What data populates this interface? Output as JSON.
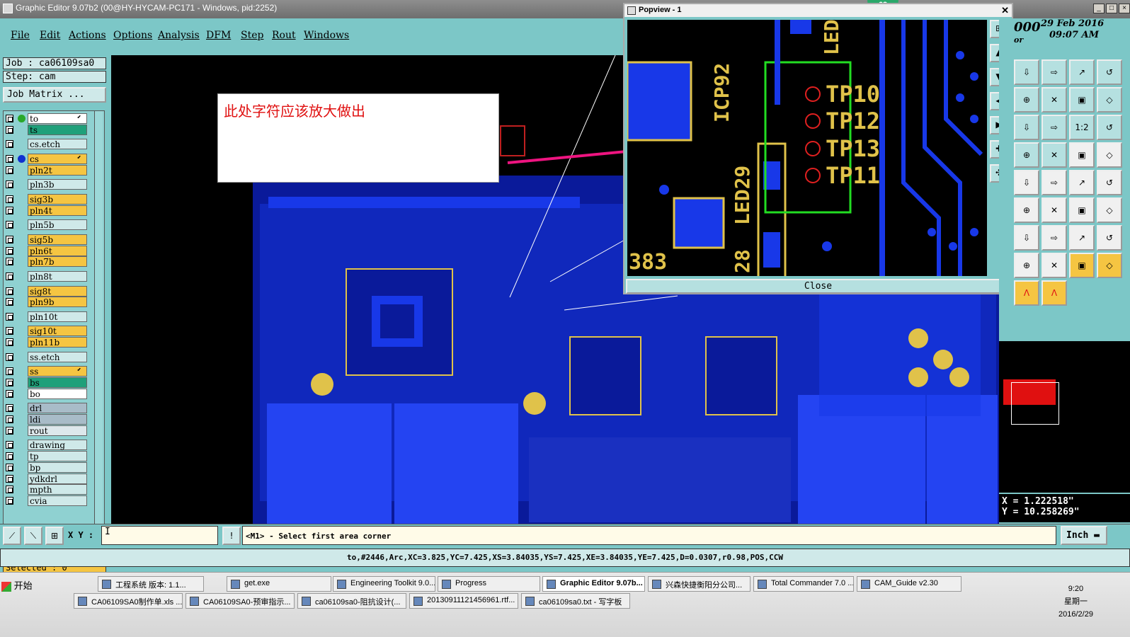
{
  "window": {
    "title": "Graphic Editor 9.07b2 (00@HY-HYCAM-PC171 - Windows, pid:2252)"
  },
  "menu": [
    "File",
    "Edit",
    "Actions",
    "Options",
    "Analysis",
    "DFM",
    "Step",
    "Rout",
    "Windows"
  ],
  "job": {
    "job_label": "Job : ca06109sa0",
    "step_label": "Step: cam",
    "matrix_button": "Job Matrix ..."
  },
  "layers": [
    {
      "name": "to",
      "color": "#ffffff",
      "dot": "#2aa82a",
      "arrow": true
    },
    {
      "name": "ts",
      "color": "#1fa07a"
    },
    {
      "name": "cs.etch",
      "color": "#cfe9e9"
    },
    {
      "name": "cs",
      "color": "#f5c542",
      "dot": "#1030d0",
      "arrow": true
    },
    {
      "name": "pln2t",
      "color": "#f5c542"
    },
    {
      "name": "pln3b",
      "color": "#cfe9e9"
    },
    {
      "name": "sig3b",
      "color": "#f5c542"
    },
    {
      "name": "pln4t",
      "color": "#f5c542"
    },
    {
      "name": "pln5b",
      "color": "#cfe9e9"
    },
    {
      "name": "sig5b",
      "color": "#f5c542"
    },
    {
      "name": "pln6t",
      "color": "#f5c542"
    },
    {
      "name": "pln7b",
      "color": "#f5c542"
    },
    {
      "name": "pln8t",
      "color": "#cfe9e9"
    },
    {
      "name": "sig8t",
      "color": "#f5c542"
    },
    {
      "name": "pln9b",
      "color": "#f5c542"
    },
    {
      "name": "pln10t",
      "color": "#cfe9e9"
    },
    {
      "name": "sig10t",
      "color": "#f5c542"
    },
    {
      "name": "pln11b",
      "color": "#f5c542"
    },
    {
      "name": "ss.etch",
      "color": "#cfe9e9"
    },
    {
      "name": "ss",
      "color": "#f5c542",
      "arrow": true
    },
    {
      "name": "bs",
      "color": "#1fa07a"
    },
    {
      "name": "bo",
      "color": "#ffffff"
    },
    {
      "name": "drl",
      "color": "#a8bcc8"
    },
    {
      "name": "ldi",
      "color": "#a8bcc8"
    },
    {
      "name": "rout",
      "color": "#dde8ec"
    },
    {
      "name": "drawing",
      "color": "#cfe9e9"
    },
    {
      "name": "tp",
      "color": "#cfe9e9"
    },
    {
      "name": "bp",
      "color": "#cfe9e9"
    },
    {
      "name": "ydkdrl",
      "color": "#cfe9e9"
    },
    {
      "name": "mpth",
      "color": "#cfe9e9"
    },
    {
      "name": "cvia",
      "color": "#cfe9e9"
    }
  ],
  "selected": "Selected : 0",
  "annotation": {
    "text": "此处字符应该放大做出"
  },
  "popview": {
    "title": "Popview - 1",
    "close": "Close",
    "labels": {
      "icp": "ICP92",
      "led29": "LED29",
      "led": "LED",
      "n383": "383",
      "n28": "28",
      "tp10": "TP10",
      "tp12": "TP12",
      "tp13": "TP13",
      "tp11": "TP11"
    }
  },
  "badge": "63",
  "date": {
    "line1": "29 Feb 2016",
    "line2": "09:07 AM",
    "left": "000",
    "left2": "or"
  },
  "coords": {
    "x": "X  =  1.222518\"",
    "y": "Y  = 10.258269\""
  },
  "toolbar_tools": [
    "1:2"
  ],
  "cmd": {
    "xy_label": "X Y :",
    "xy_value": "I",
    "prompt": "<M1> - Select first area corner",
    "unit": "Inch"
  },
  "status": "to,#2446,Arc,XC=3.825,YC=7.425,XS=3.84035,YS=7.425,XE=3.84035,YE=7.425,D=0.0307,r0.98,POS,CCW",
  "taskbar": {
    "start": "开始",
    "row1": [
      "工程系统  版本: 1.1...",
      "get.exe",
      "Engineering Toolkit 9.0...",
      "Progress",
      "Graphic Editor 9.07b...",
      "兴森快捷衡阳分公司...",
      "Total Commander 7.0 ...",
      "CAM_Guide v2.30"
    ],
    "row2": [
      "CA06109SA0制作单.xls ...",
      "CA06109SA0-预审指示...",
      "ca06109sa0-阻抗设计(...",
      "20130911121456961.rtf...",
      "ca06109sa0.txt - 写字板"
    ],
    "time": "9:20",
    "weekday": "星期一",
    "date": "2016/2/29"
  }
}
